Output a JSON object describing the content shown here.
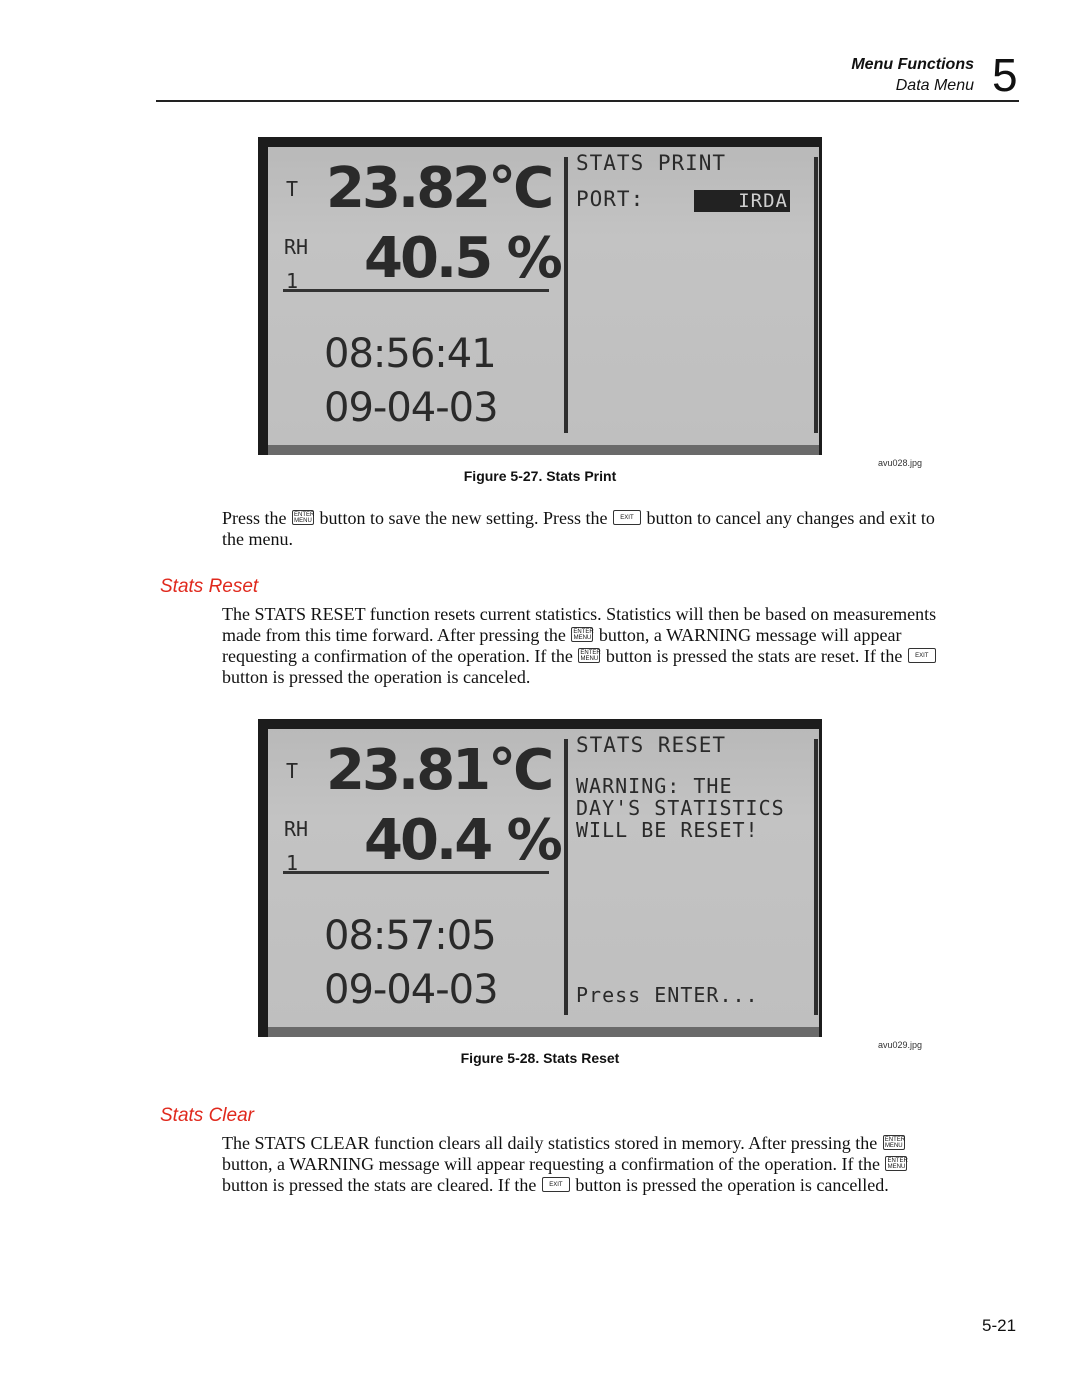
{
  "header": {
    "chapter_title": "Menu Functions",
    "section_title": "Data Menu",
    "chapter_number": "5"
  },
  "figures": [
    {
      "file": "avu028.jpg",
      "caption": "Figure 5-27. Stats Print",
      "lcd": {
        "label_t": "T",
        "label_rh": "RH",
        "label_channel": "1",
        "temperature": "23.82°C",
        "humidity": "40.5 %",
        "time": "08:56:41",
        "date": "09-04-03",
        "panel_title": "STATS PRINT",
        "port_label": "PORT:",
        "port_value": "IRDA"
      }
    },
    {
      "file": "avu029.jpg",
      "caption": "Figure 5-28. Stats Reset",
      "lcd": {
        "label_t": "T",
        "label_rh": "RH",
        "label_channel": "1",
        "temperature": "23.81°C",
        "humidity": "40.4 %",
        "time": "08:57:05",
        "date": "09-04-03",
        "panel_title": "STATS RESET",
        "warning_text": "WARNING: THE\nDAY'S STATISTICS\nWILL BE RESET!",
        "prompt": "Press ENTER..."
      }
    }
  ],
  "keys": {
    "enter_top": "ENTER",
    "enter_bottom": "MENU",
    "exit": "EXIT"
  },
  "para1": {
    "p1": "Press the ",
    "p2": " button to save the new setting. Press the ",
    "p3": " button to cancel any changes and exit to the menu."
  },
  "stats_reset": {
    "title": "Stats Reset",
    "p1": "The STATS RESET function resets current statistics. Statistics will then be based on measurements made from this time forward. After pressing the ",
    "p2": " button, a WARNING message will appear requesting a confirmation of the operation. If the ",
    "p3": " button is pressed the stats are reset. If the ",
    "p4": " button is pressed the operation is canceled."
  },
  "stats_clear": {
    "title": "Stats Clear",
    "p1": "The STATS CLEAR function clears all daily statistics stored in memory. After pressing the ",
    "p2": " button, a WARNING message will appear requesting a confirmation of the operation. If the ",
    "p3": " button is pressed the stats are cleared. If the ",
    "p4": " button is pressed the operation is cancelled."
  },
  "footer": {
    "page_number": "5-21"
  }
}
